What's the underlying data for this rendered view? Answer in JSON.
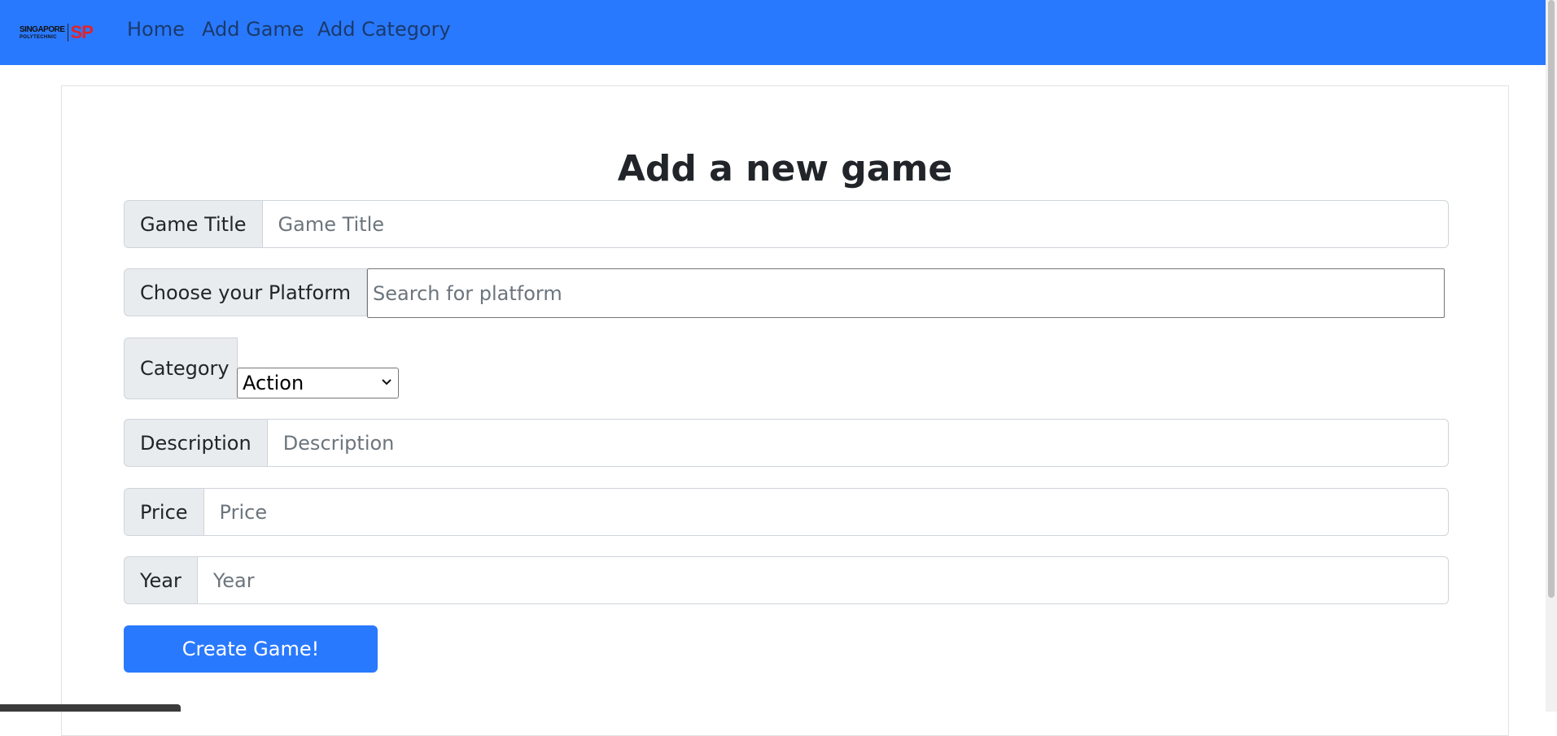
{
  "nav": {
    "logo_line1": "SINGAPORE",
    "logo_line2": "POLYTECHNIC",
    "logo_mark": "SP",
    "links": [
      "Home",
      "Add Game",
      "Add Category"
    ]
  },
  "form": {
    "heading": "Add a new game",
    "game_title": {
      "label": "Game Title",
      "placeholder": "Game Title"
    },
    "platform": {
      "label": "Choose your Platform",
      "placeholder": "Search for platform"
    },
    "category": {
      "label": "Category",
      "selected": "Action"
    },
    "description": {
      "label": "Description",
      "placeholder": "Description"
    },
    "price": {
      "label": "Price",
      "placeholder": "Price"
    },
    "year": {
      "label": "Year",
      "placeholder": "Year"
    },
    "submit_label": "Create Game!"
  },
  "colors": {
    "primary": "#2979ff",
    "addon_bg": "#e9ecef",
    "logo_red": "#e0242a"
  }
}
